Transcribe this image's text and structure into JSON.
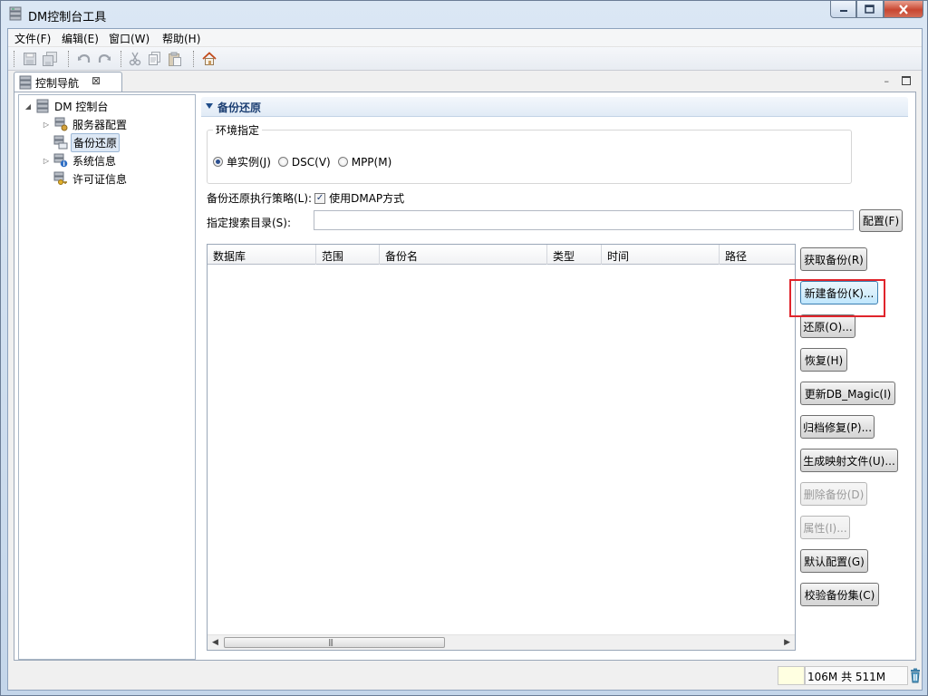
{
  "window": {
    "title": "DM控制台工具",
    "controls": {
      "minimize": "–",
      "maximize": "□",
      "close": "✕"
    }
  },
  "menubar": {
    "items": [
      "文件(F)",
      "编辑(E)",
      "窗口(W)",
      "帮助(H)"
    ]
  },
  "toolbar": {
    "icons": [
      "save-icon",
      "save-all-icon",
      "undo-icon",
      "redo-icon",
      "cut-icon",
      "copy-icon",
      "paste-icon",
      "home-icon"
    ]
  },
  "navigator": {
    "tab_label": "控制导航",
    "tab_close": "⊠",
    "tree": {
      "root": "DM 控制台",
      "items": [
        {
          "label": "服务器配置",
          "expandable": true
        },
        {
          "label": "备份还原",
          "expandable": false,
          "selected": true
        },
        {
          "label": "系统信息",
          "expandable": true
        },
        {
          "label": "许可证信息",
          "expandable": false
        }
      ]
    }
  },
  "editor": {
    "section_title": "备份还原",
    "environment": {
      "title": "环境指定",
      "options": [
        {
          "label": "单实例(J)",
          "checked": true
        },
        {
          "label": "DSC(V)",
          "checked": false
        },
        {
          "label": "MPP(M)",
          "checked": false
        }
      ]
    },
    "strategy": {
      "label": "备份还原执行策略(L):",
      "checkbox_label": "使用DMAP方式",
      "checked": true
    },
    "search_dir": {
      "label": "指定搜索目录(S):",
      "value": "",
      "config_button": "配置(F)"
    },
    "table": {
      "columns": [
        "数据库",
        "范围",
        "备份名",
        "类型",
        "时间",
        "路径"
      ],
      "rows": []
    },
    "buttons": [
      {
        "label": "获取备份(R)",
        "enabled": true
      },
      {
        "label": "新建备份(K)...",
        "enabled": true,
        "highlighted": true
      },
      {
        "label": "还原(O)...",
        "enabled": true
      },
      {
        "label": "恢复(H)",
        "enabled": true
      },
      {
        "label": "更新DB_Magic(I)",
        "enabled": true
      },
      {
        "label": "归档修复(P)...",
        "enabled": true
      },
      {
        "label": "生成映射文件(U)...",
        "enabled": true
      },
      {
        "label": "删除备份(D)",
        "enabled": false
      },
      {
        "label": "属性(I)...",
        "enabled": false
      },
      {
        "label": "默认配置(G)",
        "enabled": true
      },
      {
        "label": "校验备份集(C)",
        "enabled": true
      }
    ]
  },
  "statusbar": {
    "memory": "106M 共 511M"
  },
  "colors": {
    "highlight_box": "#e0242b",
    "section_title": "#1c3f73",
    "selection": "#dde8f5"
  }
}
